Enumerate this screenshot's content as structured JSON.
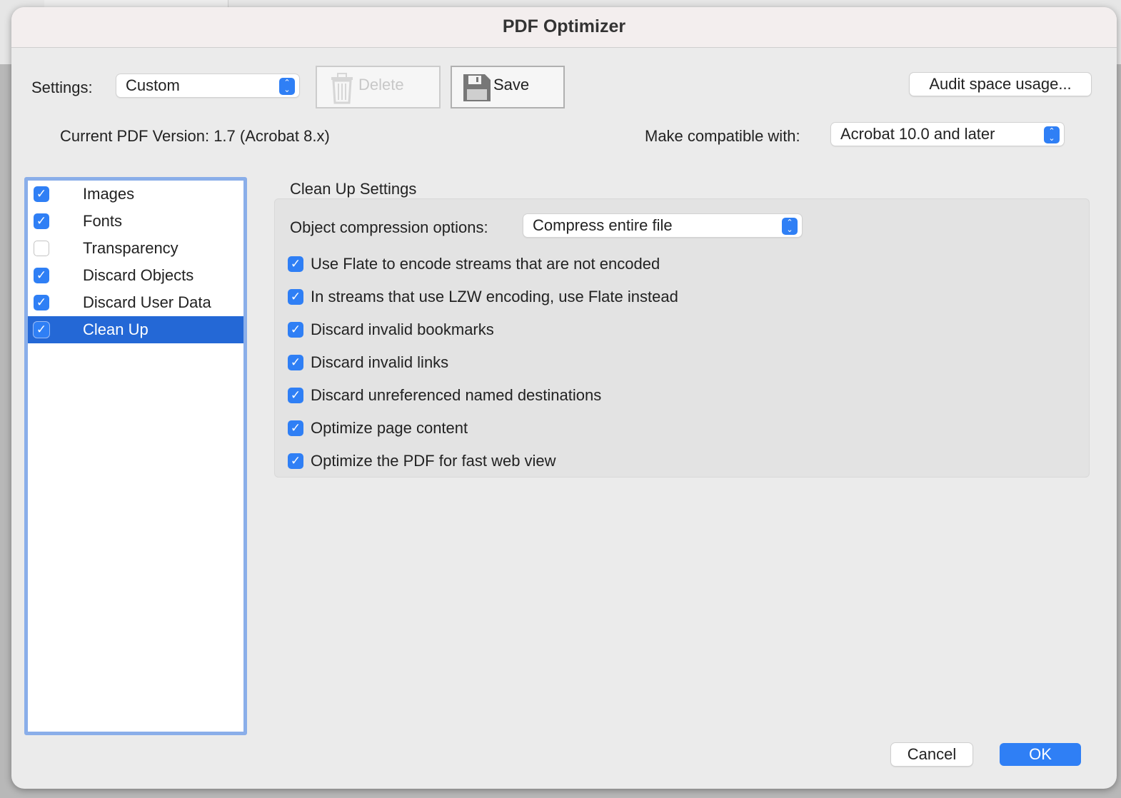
{
  "dialog": {
    "title": "PDF Optimizer"
  },
  "toolbar": {
    "settings_label": "Settings:",
    "settings_value": "Custom",
    "delete_label": "Delete",
    "save_label": "Save",
    "audit_label": "Audit space usage..."
  },
  "version": {
    "current": "Current PDF Version: 1.7 (Acrobat 8.x)",
    "compat_label": "Make compatible with:",
    "compat_value": "Acrobat 10.0 and later"
  },
  "panels": [
    {
      "label": "Images",
      "checked": true
    },
    {
      "label": "Fonts",
      "checked": true
    },
    {
      "label": "Transparency",
      "checked": false
    },
    {
      "label": "Discard Objects",
      "checked": true
    },
    {
      "label": "Discard User Data",
      "checked": true
    },
    {
      "label": "Clean Up",
      "checked": true,
      "selected": true
    }
  ],
  "cleanup": {
    "title": "Clean Up Settings",
    "compression_label": "Object compression options:",
    "compression_value": "Compress entire file",
    "options": [
      {
        "label": "Use Flate to encode streams that are not encoded",
        "checked": true
      },
      {
        "label": "In streams that use LZW encoding, use Flate instead",
        "checked": true
      },
      {
        "label": "Discard invalid bookmarks",
        "checked": true
      },
      {
        "label": "Discard invalid links",
        "checked": true
      },
      {
        "label": "Discard unreferenced named destinations",
        "checked": true
      },
      {
        "label": "Optimize page content",
        "checked": true
      },
      {
        "label": "Optimize the PDF for fast web view",
        "checked": true
      }
    ]
  },
  "footer": {
    "cancel_label": "Cancel",
    "ok_label": "OK"
  },
  "colors": {
    "accent": "#2f7ff5",
    "selection": "#2468d6",
    "list_border": "#8aaee9"
  }
}
